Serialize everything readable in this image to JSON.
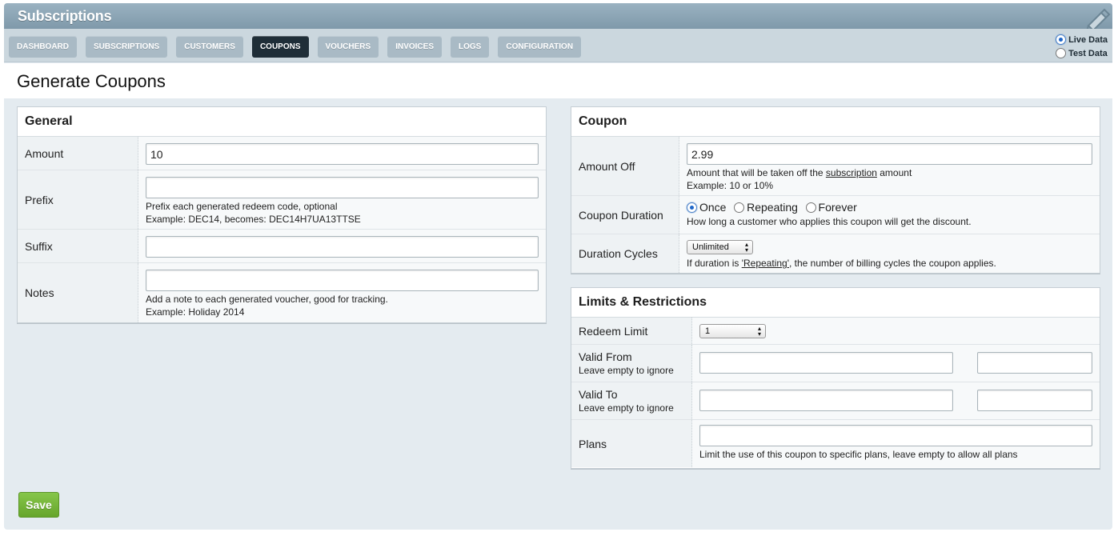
{
  "app": {
    "title": "Subscriptions"
  },
  "nav": {
    "tabs": [
      {
        "label": "DASHBOARD"
      },
      {
        "label": "SUBSCRIPTIONS"
      },
      {
        "label": "CUSTOMERS"
      },
      {
        "label": "COUPONS"
      },
      {
        "label": "VOUCHERS"
      },
      {
        "label": "INVOICES"
      },
      {
        "label": "LOGS"
      },
      {
        "label": "CONFIGURATION"
      }
    ],
    "active_tab": "COUPONS",
    "mode": {
      "live_label": "Live Data",
      "test_label": "Test Data",
      "selected": "Live Data"
    }
  },
  "page": {
    "title": "Generate Coupons"
  },
  "general": {
    "heading": "General",
    "amount": {
      "label": "Amount",
      "value": "10"
    },
    "prefix": {
      "label": "Prefix",
      "value": "",
      "help1": "Prefix each generated redeem code, optional",
      "help2": "Example: DEC14, becomes: DEC14H7UA13TTSE"
    },
    "suffix": {
      "label": "Suffix",
      "value": ""
    },
    "notes": {
      "label": "Notes",
      "value": "",
      "help1": "Add a note to each generated voucher, good for tracking.",
      "help2": "Example: Holiday 2014"
    }
  },
  "coupon": {
    "heading": "Coupon",
    "amount_off": {
      "label": "Amount Off",
      "value": "2.99",
      "help1_pre": "Amount that will be taken off the ",
      "help1_link": "subscription",
      "help1_post": " amount",
      "help2": "Example: 10 or 10%"
    },
    "duration": {
      "label": "Coupon Duration",
      "options": [
        "Once",
        "Repeating",
        "Forever"
      ],
      "selected": "Once",
      "help": "How long a customer who applies this coupon will get the discount."
    },
    "cycles": {
      "label": "Duration Cycles",
      "value": "Unlimited",
      "help_pre": "If duration is ",
      "help_link": "'Repeating'",
      "help_post": ", the number of billing cycles the coupon applies."
    }
  },
  "limits": {
    "heading": "Limits & Restrictions",
    "redeem_limit": {
      "label": "Redeem Limit",
      "value": "1"
    },
    "valid_from": {
      "label": "Valid From",
      "sub": "Leave empty to ignore",
      "date": "",
      "time": ""
    },
    "valid_to": {
      "label": "Valid To",
      "sub": "Leave empty to ignore",
      "date": "",
      "time": ""
    },
    "plans": {
      "label": "Plans",
      "value": "",
      "help": "Limit the use of this coupon to specific plans, leave empty to allow all plans"
    }
  },
  "actions": {
    "save_label": "Save"
  },
  "colors": {
    "accent_green": "#6aaa2f",
    "active_tab": "#1f2e38",
    "tab": "#a9bac5",
    "titlebar": "#8aa4b4"
  }
}
